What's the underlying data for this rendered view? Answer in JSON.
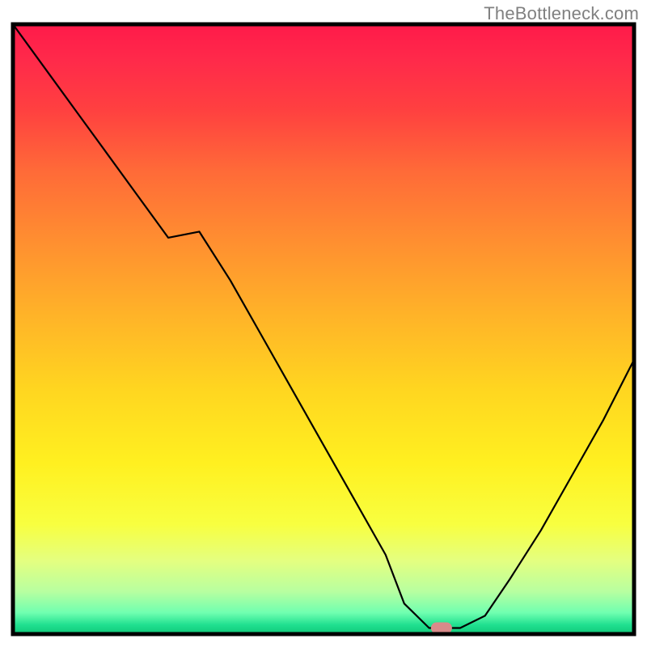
{
  "watermark": "TheBottleneck.com",
  "colors": {
    "frame": "#000000",
    "curve": "#000000",
    "marker_fill": "#d98a8a",
    "gradient_stops": [
      {
        "offset": 0.0,
        "color": "#ff1a4a"
      },
      {
        "offset": 0.06,
        "color": "#ff2a4a"
      },
      {
        "offset": 0.14,
        "color": "#ff4040"
      },
      {
        "offset": 0.24,
        "color": "#ff6a38"
      },
      {
        "offset": 0.36,
        "color": "#ff9030"
      },
      {
        "offset": 0.48,
        "color": "#ffb428"
      },
      {
        "offset": 0.6,
        "color": "#ffd620"
      },
      {
        "offset": 0.72,
        "color": "#fff020"
      },
      {
        "offset": 0.82,
        "color": "#f8ff40"
      },
      {
        "offset": 0.88,
        "color": "#e4ff80"
      },
      {
        "offset": 0.93,
        "color": "#b8ffa0"
      },
      {
        "offset": 0.965,
        "color": "#70ffb0"
      },
      {
        "offset": 0.985,
        "color": "#20e090"
      },
      {
        "offset": 1.0,
        "color": "#10c878"
      }
    ]
  },
  "chart_data": {
    "type": "line",
    "title": "",
    "xlabel": "",
    "ylabel": "",
    "xlim": [
      0,
      100
    ],
    "ylim": [
      0,
      100
    ],
    "series": [
      {
        "name": "bottleneck-curve",
        "x": [
          0,
          5,
          10,
          15,
          20,
          25,
          30,
          35,
          40,
          45,
          50,
          55,
          60,
          63,
          67,
          70,
          72,
          76,
          80,
          85,
          90,
          95,
          100
        ],
        "y": [
          100,
          93,
          86,
          79,
          72,
          65,
          66,
          58,
          49,
          40,
          31,
          22,
          13,
          5,
          1,
          1,
          1,
          3,
          9,
          17,
          26,
          35,
          45
        ]
      }
    ],
    "marker": {
      "x": 69,
      "y": 1,
      "shape": "pill"
    },
    "annotations": []
  }
}
